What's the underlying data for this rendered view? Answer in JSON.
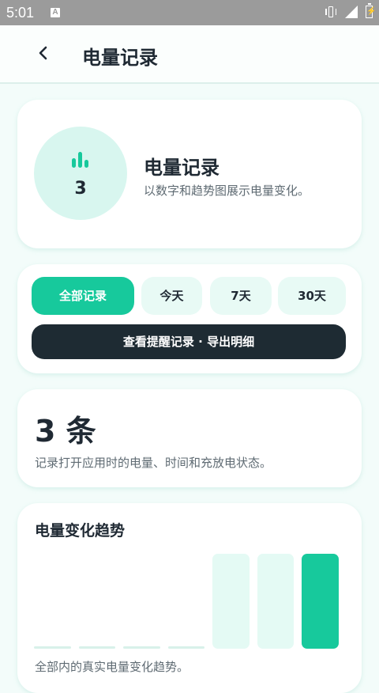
{
  "status_bar": {
    "time": "5:01",
    "notification_icon": "a-icon",
    "icons": [
      "vibrate-icon",
      "signal-icon",
      "battery-charging-icon"
    ]
  },
  "header": {
    "back_icon": "chevron-left-icon",
    "title": "电量记录"
  },
  "hero": {
    "icon": "bar-chart-icon",
    "count": "3",
    "title": "电量记录",
    "description": "以数字和趋势图展示电量变化。"
  },
  "filters": {
    "tabs": [
      {
        "label": "全部记录",
        "active": true
      },
      {
        "label": "今天",
        "active": false
      },
      {
        "label": "7天",
        "active": false
      },
      {
        "label": "30天",
        "active": false
      }
    ],
    "action_label": "查看提醒记录 · 导出明细"
  },
  "summary": {
    "value": "3 条",
    "description": "记录打开应用时的电量、时间和充放电状态。"
  },
  "trend": {
    "title": "电量变化趋势",
    "caption": "全部内的真实电量变化趋势。",
    "levels": [
      0,
      0,
      0,
      0,
      0.97,
      0.97,
      0.97
    ],
    "highlight_index": 6
  },
  "colors": {
    "accent": "#17c99c",
    "accent_light": "#e8faf5",
    "dark": "#1e2b33",
    "text": "#1f2933",
    "muted": "#5f6b73"
  }
}
